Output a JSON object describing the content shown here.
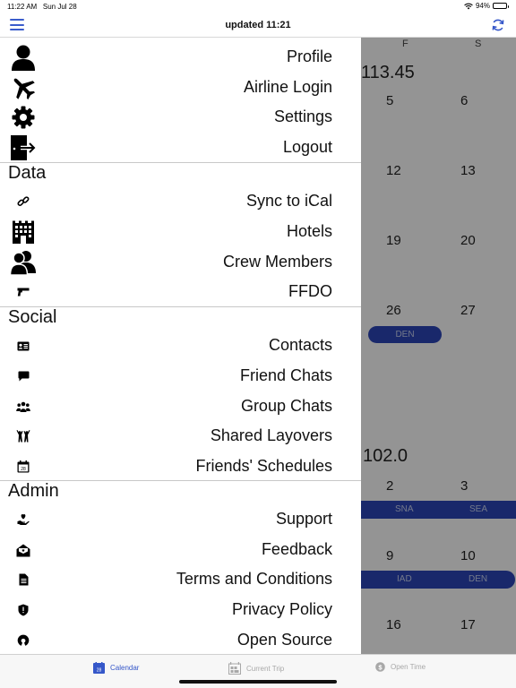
{
  "status": {
    "time": "11:22 AM",
    "date": "Sun Jul 28",
    "battery": "94%"
  },
  "navbar": {
    "title": "updated 11:21"
  },
  "calendar": {
    "day_headers": [
      "F",
      "S"
    ],
    "amounts": [
      "113.45",
      "102.0"
    ],
    "week1": [
      "5",
      "6"
    ],
    "week2": [
      "12",
      "13"
    ],
    "week3": [
      "19",
      "20"
    ],
    "week4": [
      "26",
      "27"
    ],
    "week5": [
      "2",
      "3"
    ],
    "week6": [
      "9",
      "10"
    ],
    "week7": [
      "16",
      "17"
    ],
    "labels": {
      "den1": "DEN",
      "sna": "SNA",
      "sea": "SEA",
      "iad": "IAD",
      "den2": "DEN"
    }
  },
  "menu": {
    "profile": "Profile",
    "airline_login": "Airline Login",
    "settings": "Settings",
    "logout": "Logout",
    "data_title": "Data",
    "sync_ical": "Sync to iCal",
    "hotels": "Hotels",
    "crew_members": "Crew Members",
    "ffdo": "FFDO",
    "social_title": "Social",
    "contacts": "Contacts",
    "friend_chats": "Friend Chats",
    "group_chats": "Group Chats",
    "shared_layovers": "Shared Layovers",
    "friends_schedules": "Friends' Schedules",
    "admin_title": "Admin",
    "support": "Support",
    "feedback": "Feedback",
    "terms": "Terms and Conditions",
    "privacy": "Privacy Policy",
    "open_source": "Open Source"
  },
  "icons": {
    "calendar_day": "28"
  },
  "tabbar": {
    "calendar": "Calendar",
    "current_trip": "Current Trip",
    "open_time": "Open Time"
  },
  "colors": {
    "accent": "#3557c9",
    "flight_bar": "#2c45b8"
  }
}
